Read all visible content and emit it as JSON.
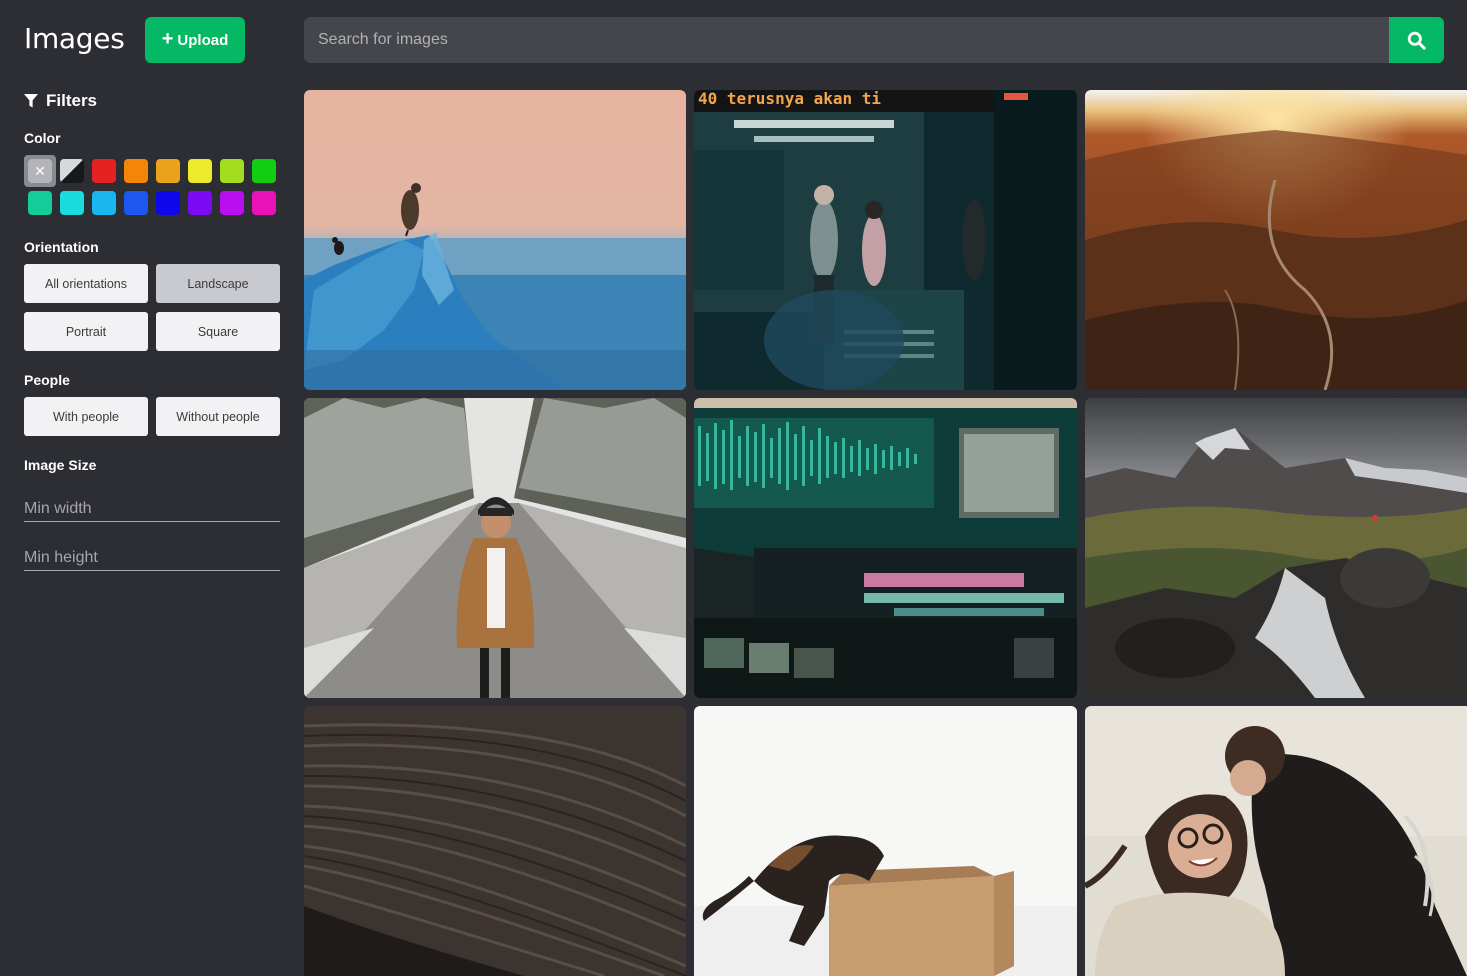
{
  "header": {
    "brand": "Images",
    "upload_label": "Upload",
    "search_placeholder": "Search for images"
  },
  "sidebar": {
    "filters_title": "Filters",
    "color": {
      "label": "Color",
      "swatches": [
        {
          "name": "clear",
          "hex": "#b4b5ba"
        },
        {
          "name": "black-white",
          "hex": "#17181c"
        },
        {
          "name": "red",
          "hex": "#e62221"
        },
        {
          "name": "orange",
          "hex": "#f5840b"
        },
        {
          "name": "amber",
          "hex": "#eaa21d"
        },
        {
          "name": "yellow",
          "hex": "#ecea2b"
        },
        {
          "name": "lime",
          "hex": "#a2dd1e"
        },
        {
          "name": "green",
          "hex": "#13cd13"
        },
        {
          "name": "teal",
          "hex": "#13cc97"
        },
        {
          "name": "turquoise",
          "hex": "#1adcdc"
        },
        {
          "name": "cyan",
          "hex": "#1ab6ef"
        },
        {
          "name": "blue",
          "hex": "#1c57f0"
        },
        {
          "name": "deep-blue",
          "hex": "#0d07ea"
        },
        {
          "name": "violet",
          "hex": "#7a0bf3"
        },
        {
          "name": "purple",
          "hex": "#b90ef0"
        },
        {
          "name": "magenta",
          "hex": "#e812b7"
        }
      ]
    },
    "orientation": {
      "label": "Orientation",
      "options": [
        "All orientations",
        "Landscape",
        "Portrait",
        "Square"
      ],
      "selected": "Landscape"
    },
    "people": {
      "label": "People",
      "options": [
        "With people",
        "Without people"
      ]
    },
    "image_size": {
      "label": "Image Size",
      "min_width_placeholder": "Min width",
      "min_height_placeholder": "Min height"
    }
  },
  "gallery": {
    "tiles": [
      {
        "subject": "eagle on ice",
        "caption": ""
      },
      {
        "subject": "subway station",
        "caption": "40 terusnya akan ti"
      },
      {
        "subject": "canyon sunset",
        "caption": ""
      },
      {
        "subject": "woman snowy road",
        "caption": ""
      },
      {
        "subject": "audio editing screen",
        "caption": ""
      },
      {
        "subject": "mountain waterfall",
        "caption": ""
      },
      {
        "subject": "wood curve",
        "caption": ""
      },
      {
        "subject": "cat and box",
        "caption": ""
      },
      {
        "subject": "couple in snow",
        "caption": ""
      }
    ]
  }
}
